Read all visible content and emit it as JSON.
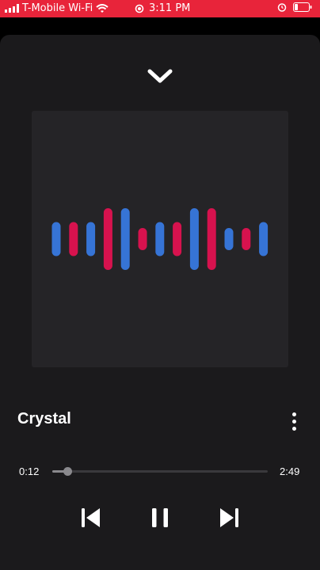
{
  "status_bar": {
    "carrier": "T-Mobile Wi-Fi",
    "time": "3:11 PM",
    "accent": "#e8243a"
  },
  "player": {
    "collapse_icon": "chevron-down-icon",
    "track_title": "Crystal",
    "more_icon": "more-vertical-icon",
    "elapsed": "0:12",
    "duration": "2:49",
    "progress": 0.071,
    "controls": {
      "previous_icon": "skip-previous-icon",
      "pause_icon": "pause-icon",
      "next_icon": "skip-next-icon"
    }
  },
  "artwork": {
    "waveform_colors": {
      "blue": "#3674d6",
      "red": "#d7124e"
    },
    "waveform_levels": [
      {
        "color": "blue",
        "level": 0.55
      },
      {
        "color": "red",
        "level": 0.55
      },
      {
        "color": "blue",
        "level": 0.55
      },
      {
        "color": "red",
        "level": 1.0
      },
      {
        "color": "blue",
        "level": 1.0
      },
      {
        "color": "red",
        "level": 0.36
      },
      {
        "color": "blue",
        "level": 0.55
      },
      {
        "color": "red",
        "level": 0.55
      },
      {
        "color": "blue",
        "level": 1.0
      },
      {
        "color": "red",
        "level": 1.0
      },
      {
        "color": "blue",
        "level": 0.36
      },
      {
        "color": "red",
        "level": 0.36
      },
      {
        "color": "blue",
        "level": 0.55
      }
    ]
  }
}
